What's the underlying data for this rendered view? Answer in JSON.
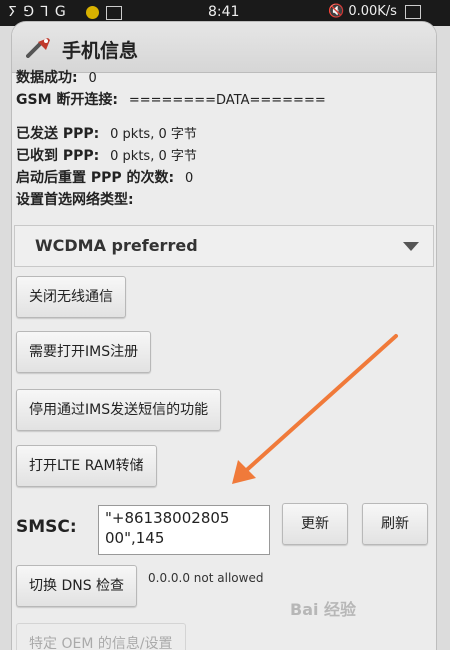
{
  "status_bar": {
    "left": "ⵢ ⅁ ⅂ G",
    "time": "8:41",
    "network": "0.00K/s"
  },
  "app": {
    "title": "手机信息"
  },
  "info": {
    "data_success_label": "数据成功:",
    "data_success_value": "0",
    "gsm_label": "GSM 断开连接:",
    "gsm_value": "========DATA=======",
    "ppp_sent_label": "已发送 PPP:",
    "ppp_sent_value": "0 pkts, 0 字节",
    "ppp_recv_label": "已收到 PPP:",
    "ppp_recv_value": "0 pkts, 0 字节",
    "ppp_reset_label": "启动后重置 PPP 的次数:",
    "ppp_reset_value": "0",
    "net_type_label": "设置首选网络类型:"
  },
  "network_type": {
    "selected": "WCDMA preferred"
  },
  "buttons": {
    "radio_off": "关闭无线通信",
    "ims_register": "需要打开IMS注册",
    "ims_sms": "停用通过IMS发送短信的功能",
    "lte_ram": "打开LTE RAM转储",
    "update": "更新",
    "refresh": "刷新",
    "dns_check": "切换 DNS 检查",
    "oem_info": "特定 OEM 的信息/设置"
  },
  "smsc": {
    "label": "SMSC:",
    "value": "\"+86138002805\n00\",145"
  },
  "dns_status": "0.0.0.0 not allowed",
  "colors": {
    "annotation_arrow": "#f07a3a"
  },
  "watermark": "Bai 经验"
}
